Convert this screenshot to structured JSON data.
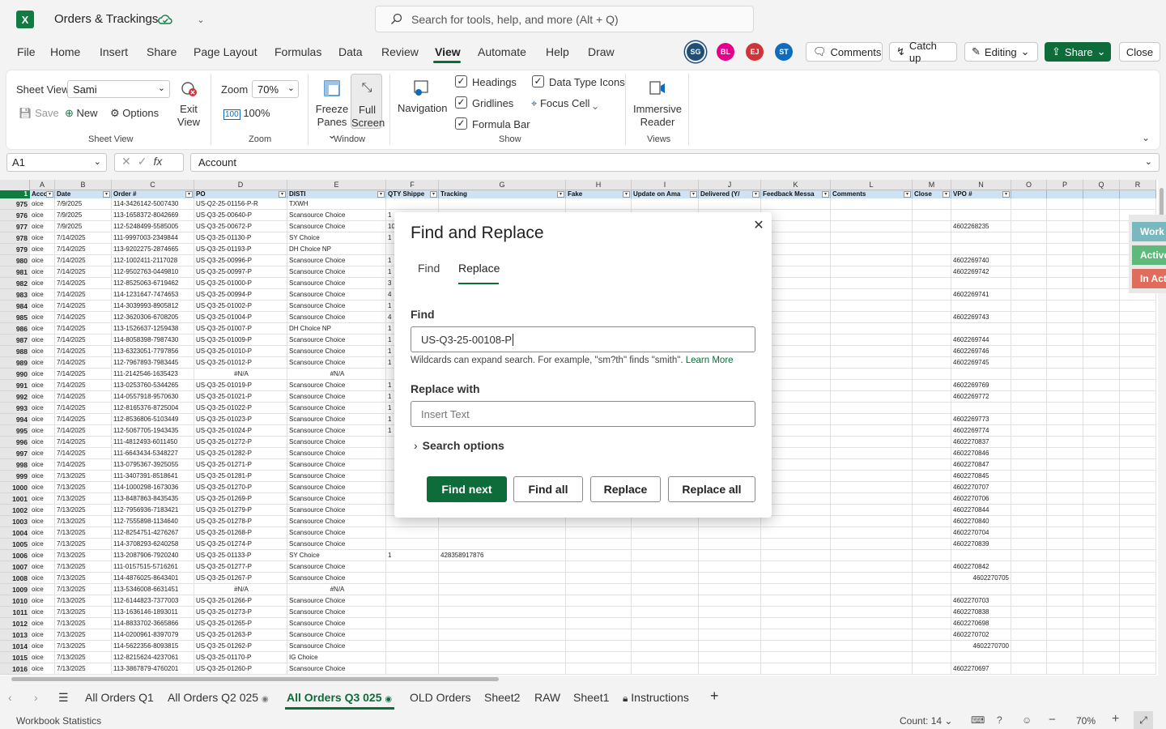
{
  "app": {
    "title": "Orders & Trackings"
  },
  "search": {
    "placeholder": "Search for tools, help, and more (Alt + Q)"
  },
  "menu": [
    "File",
    "Home",
    "Insert",
    "Share",
    "Page Layout",
    "Formulas",
    "Data",
    "Review",
    "View",
    "Automate",
    "Help",
    "Draw"
  ],
  "active_menu": "View",
  "avatars": [
    {
      "initials": "SG",
      "color": "#1f4e79"
    },
    {
      "initials": "BL",
      "color": "#e3008c"
    },
    {
      "initials": "EJ",
      "color": "#d13438"
    },
    {
      "initials": "ST",
      "color": "#0f6cbd"
    }
  ],
  "topbuttons": {
    "comments": "Comments",
    "catchup": "Catch up",
    "editing": "Editing",
    "share": "Share",
    "close": "Close"
  },
  "ribbon": {
    "sheetview_label": "Sheet View",
    "sheetview_value": "Sami",
    "save": "Save",
    "new": "New",
    "options": "Options",
    "exit_view": "Exit View",
    "group_sheetview": "Sheet View",
    "zoom_label": "Zoom",
    "zoom_value": "70%",
    "zoom100": "100%",
    "group_zoom": "Zoom",
    "freeze_panes": "Freeze Panes",
    "full_screen": "Full Screen",
    "group_window": "Window",
    "navigation": "Navigation",
    "headings": "Headings",
    "gridlines": "Gridlines",
    "formula_bar": "Formula Bar",
    "data_type_icons": "Data Type Icons",
    "focus_cell": "Focus Cell",
    "group_show": "Show",
    "immersive_reader": "Immersive Reader",
    "group_views": "Views"
  },
  "formula": {
    "namebox": "A1",
    "content": "Account"
  },
  "grid": {
    "columns": [
      "A",
      "B",
      "C",
      "D",
      "E",
      "F",
      "G",
      "H",
      "I",
      "J",
      "K",
      "L",
      "M",
      "N",
      "O",
      "P",
      "Q",
      "R"
    ],
    "headers": [
      "Accou",
      "Date",
      "Order #",
      "PO",
      "DISTI",
      "QTY Shippe",
      "Tracking",
      "Fake",
      "Update on Ama",
      "Delivered (Y/",
      "Feedback Messa",
      "Comments",
      "Close",
      "VPO #",
      "",
      "",
      "",
      ""
    ],
    "rows": [
      [
        "975",
        "oice",
        "7/9/2025",
        "114-3426142-5007430",
        "US-Q2-25-01156-P-R",
        "TXWH",
        "",
        "",
        ""
      ],
      [
        "976",
        "oice",
        "7/9/2025",
        "113-1658372-8042669",
        "US-Q3-25-00640-P",
        "Scansource Choice",
        "1",
        "",
        ""
      ],
      [
        "977",
        "oice",
        "7/9/2025",
        "112-5248499-5585005",
        "US-Q3-25-00672-P",
        "Scansource Choice",
        "10",
        "",
        "4602268235"
      ],
      [
        "978",
        "oice",
        "7/14/2025",
        "111-9997003-2349844",
        "US-Q3-25-01130-P",
        "SY Choice",
        "1",
        "",
        ""
      ],
      [
        "979",
        "oice",
        "7/14/2025",
        "113-9202275-2874665",
        "US-Q3-25-01193-P",
        "DH Choice NP",
        "",
        "",
        ""
      ],
      [
        "980",
        "oice",
        "7/14/2025",
        "112-1002411-2117028",
        "US-Q3-25-00996-P",
        "Scansource Choice",
        "1",
        "",
        "4602269740"
      ],
      [
        "981",
        "oice",
        "7/14/2025",
        "112-9502763-0449810",
        "US-Q3-25-00997-P",
        "Scansource Choice",
        "1",
        "",
        "4602269742"
      ],
      [
        "982",
        "oice",
        "7/14/2025",
        "112-8525063-6719462",
        "US-Q3-25-01000-P",
        "Scansource Choice",
        "3",
        "",
        ""
      ],
      [
        "983",
        "oice",
        "7/14/2025",
        "114-1231647-7474653",
        "US-Q3-25-00994-P",
        "Scansource Choice",
        "4",
        "",
        "4602269741"
      ],
      [
        "984",
        "oice",
        "7/14/2025",
        "114-3039993-8905812",
        "US-Q3-25-01002-P",
        "Scansource Choice",
        "1",
        "",
        ""
      ],
      [
        "985",
        "oice",
        "7/14/2025",
        "112-3620306-6708205",
        "US-Q3-25-01004-P",
        "Scansource Choice",
        "4",
        "",
        "4602269743"
      ],
      [
        "986",
        "oice",
        "7/14/2025",
        "113-1526637-1259438",
        "US-Q3-25-01007-P",
        "DH Choice NP",
        "1",
        "",
        ""
      ],
      [
        "987",
        "oice",
        "7/14/2025",
        "114-8058398-7987430",
        "US-Q3-25-01009-P",
        "Scansource Choice",
        "1",
        "",
        "4602269744"
      ],
      [
        "988",
        "oice",
        "7/14/2025",
        "113-6323051-7797856",
        "US-Q3-25-01010-P",
        "Scansource Choice",
        "1",
        "",
        "4602269746"
      ],
      [
        "989",
        "oice",
        "7/14/2025",
        "112-7967893-7983445",
        "US-Q3-25-01012-P",
        "Scansource Choice",
        "1",
        "",
        "4602269745"
      ],
      [
        "990",
        "oice",
        "7/14/2025",
        "111-2142546-1635423",
        "#N/A",
        "#N/A",
        "",
        "",
        ""
      ],
      [
        "991",
        "oice",
        "7/14/2025",
        "113-0253760-5344265",
        "US-Q3-25-01019-P",
        "Scansource Choice",
        "1",
        "",
        "4602269769"
      ],
      [
        "992",
        "oice",
        "7/14/2025",
        "114-0557918-9570630",
        "US-Q3-25-01021-P",
        "Scansource Choice",
        "1",
        "",
        "4602269772"
      ],
      [
        "993",
        "oice",
        "7/14/2025",
        "112-8165376-8725004",
        "US-Q3-25-01022-P",
        "Scansource Choice",
        "1",
        "",
        ""
      ],
      [
        "994",
        "oice",
        "7/14/2025",
        "112-8536806-5103449",
        "US-Q3-25-01023-P",
        "Scansource Choice",
        "1",
        "",
        "4602269773"
      ],
      [
        "995",
        "oice",
        "7/14/2025",
        "112-5067705-1943435",
        "US-Q3-25-01024-P",
        "Scansource Choice",
        "1",
        "",
        "4602269774"
      ],
      [
        "996",
        "oice",
        "7/14/2025",
        "111-4812493-6011450",
        "US-Q3-25-01272-P",
        "Scansource Choice",
        "",
        "",
        "4602270837"
      ],
      [
        "997",
        "oice",
        "7/14/2025",
        "111-6643434-5348227",
        "US-Q3-25-01282-P",
        "Scansource Choice",
        "",
        "",
        "4602270846"
      ],
      [
        "998",
        "oice",
        "7/14/2025",
        "113-0795367-3925055",
        "US-Q3-25-01271-P",
        "Scansource Choice",
        "",
        "",
        "4602270847"
      ],
      [
        "999",
        "oice",
        "7/13/2025",
        "111-3407391-8518641",
        "US-Q3-25-01281-P",
        "Scansource Choice",
        "",
        "",
        "4602270845"
      ],
      [
        "1000",
        "oice",
        "7/13/2025",
        "114-1000298-1673036",
        "US-Q3-25-01270-P",
        "Scansource Choice",
        "",
        "",
        "4602270707"
      ],
      [
        "1001",
        "oice",
        "7/13/2025",
        "113-8487863-8435435",
        "US-Q3-25-01269-P",
        "Scansource Choice",
        "",
        "",
        "4602270706"
      ],
      [
        "1002",
        "oice",
        "7/13/2025",
        "112-7956936-7183421",
        "US-Q3-25-01279-P",
        "Scansource Choice",
        "",
        "",
        "4602270844"
      ],
      [
        "1003",
        "oice",
        "7/13/2025",
        "112-7555898-1134640",
        "US-Q3-25-01278-P",
        "Scansource Choice",
        "",
        "",
        "4602270840"
      ],
      [
        "1004",
        "oice",
        "7/13/2025",
        "112-8254751-4276267",
        "US-Q3-25-01268-P",
        "Scansource Choice",
        "",
        "",
        "4602270704"
      ],
      [
        "1005",
        "oice",
        "7/13/2025",
        "114-3708293-6240258",
        "US-Q3-25-01274-P",
        "Scansource Choice",
        "",
        "",
        "4602270839"
      ],
      [
        "1006",
        "oice",
        "7/13/2025",
        "113-2087906-7920240",
        "US-Q3-25-01133-P",
        "SY Choice",
        "1",
        "428358917876",
        ""
      ],
      [
        "1007",
        "oice",
        "7/13/2025",
        "111-0157515-5716261",
        "US-Q3-25-01277-P",
        "Scansource Choice",
        "",
        "",
        "4602270842"
      ],
      [
        "1008",
        "oice",
        "7/13/2025",
        "114-4876025-8643401",
        "US-Q3-25-01267-P",
        "Scansource Choice",
        "",
        "",
        "4602270705"
      ],
      [
        "1009",
        "oice",
        "7/13/2025",
        "113-5346008-6631451",
        "#N/A",
        "#N/A",
        "",
        "",
        ""
      ],
      [
        "1010",
        "oice",
        "7/13/2025",
        "112-6144823-7377003",
        "US-Q3-25-01266-P",
        "Scansource Choice",
        "",
        "",
        "4602270703"
      ],
      [
        "1011",
        "oice",
        "7/13/2025",
        "113-1636146-1893011",
        "US-Q3-25-01273-P",
        "Scansource Choice",
        "",
        "",
        "4602270838"
      ],
      [
        "1012",
        "oice",
        "7/13/2025",
        "114-8833702-3665866",
        "US-Q3-25-01265-P",
        "Scansource Choice",
        "",
        "",
        "4602270698"
      ],
      [
        "1013",
        "oice",
        "7/13/2025",
        "114-0200961-8397079",
        "US-Q3-25-01263-P",
        "Scansource Choice",
        "",
        "",
        "4602270702"
      ],
      [
        "1014",
        "oice",
        "7/13/2025",
        "114-5622356-8093815",
        "US-Q3-25-01262-P",
        "Scansource Choice",
        "",
        "",
        "4602270700"
      ],
      [
        "1015",
        "oice",
        "7/13/2025",
        "112-8215624-4237061",
        "US-Q3-25-01170-P",
        "IG Choice",
        "",
        "",
        ""
      ],
      [
        "1016",
        "oice",
        "7/13/2025",
        "113-3867879-4760201",
        "US-Q3-25-01260-P",
        "Scansource Choice",
        "",
        "",
        "4602270697"
      ]
    ]
  },
  "side_cards": [
    {
      "label": "Work",
      "color": "#7ab8c0"
    },
    {
      "label": "Active",
      "color": "#5fb97b"
    },
    {
      "label": "In Act",
      "color": "#e06c5c"
    }
  ],
  "dialog": {
    "title": "Find and Replace",
    "tab_find": "Find",
    "tab_replace": "Replace",
    "find_label": "Find",
    "find_value": "US-Q3-25-00108-P",
    "hint": "Wildcards can expand search. For example, \"sm?th\" finds \"smith\".",
    "learn_more": "Learn More",
    "replace_label": "Replace with",
    "replace_placeholder": "Insert Text",
    "search_options": "Search options",
    "find_next": "Find next",
    "find_all": "Find all",
    "replace": "Replace",
    "replace_all": "Replace all"
  },
  "sheets": [
    "All Orders Q1",
    "All Orders Q2 025",
    "All Orders Q3 025",
    "OLD Orders",
    "Sheet2",
    "RAW",
    "Sheet1",
    "Instructions"
  ],
  "active_sheet": "All Orders Q3 025",
  "status": {
    "left": "Workbook Statistics",
    "count": "Count: 14",
    "zoom": "70%"
  }
}
